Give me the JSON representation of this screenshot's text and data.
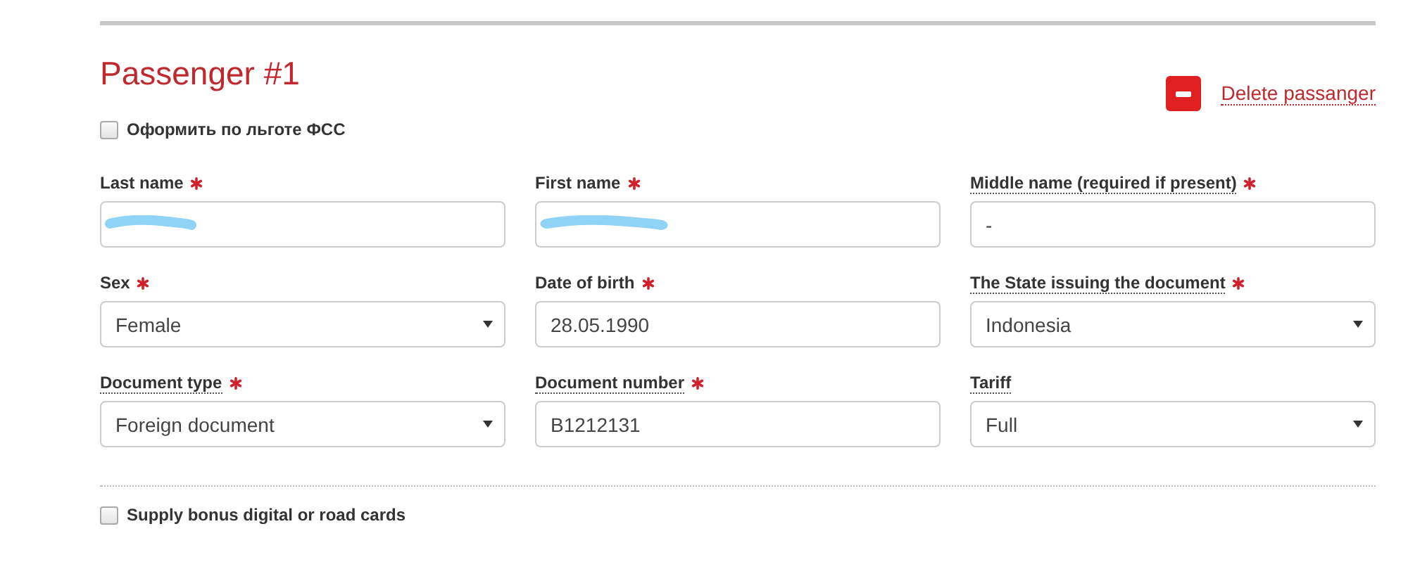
{
  "passenger": {
    "title": "Passenger #1",
    "delete_label": "Delete passanger"
  },
  "benefit_checkbox": {
    "label": "Оформить по льготе ФСС",
    "checked": false
  },
  "fields": [
    {
      "kind": "text",
      "label": "Last name",
      "required": true,
      "hint": false,
      "redacted": true
    },
    {
      "kind": "text",
      "label": "First name",
      "required": true,
      "hint": false,
      "redacted": true
    },
    {
      "kind": "text",
      "label": "Middle name (required if present)",
      "required": true,
      "hint": true,
      "value": "-"
    },
    {
      "kind": "select",
      "label": "Sex",
      "required": true,
      "hint": false,
      "value": "Female"
    },
    {
      "kind": "text",
      "label": "Date of birth",
      "required": true,
      "hint": false,
      "value": "28.05.1990"
    },
    {
      "kind": "select",
      "label": "The State issuing the document",
      "required": true,
      "hint": true,
      "value": "Indonesia"
    },
    {
      "kind": "select",
      "label": "Document type",
      "required": true,
      "hint": true,
      "value": "Foreign document"
    },
    {
      "kind": "text",
      "label": "Document number",
      "required": true,
      "hint": true,
      "value": "B1212131"
    },
    {
      "kind": "select",
      "label": "Tariff",
      "required": false,
      "hint": true,
      "value": "Full"
    }
  ],
  "bonus_checkbox": {
    "label": "Supply bonus digital or road cards",
    "checked": false
  }
}
